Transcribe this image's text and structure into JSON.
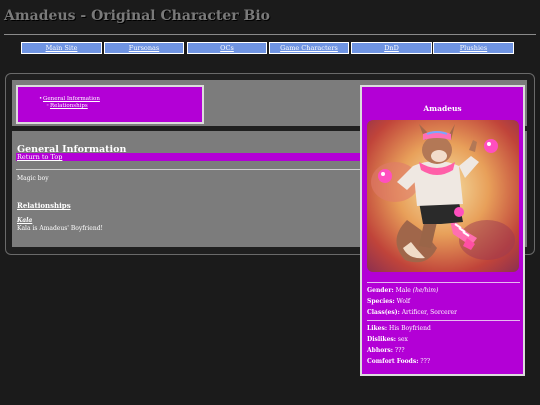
{
  "page": {
    "title": "Amadeus - Original Character Bio"
  },
  "nav": [
    {
      "label": "Main Site"
    },
    {
      "label": "Fursonas"
    },
    {
      "label": "OCs"
    },
    {
      "label": "Game Characters"
    },
    {
      "label": "DnD"
    },
    {
      "label": "Plushies"
    }
  ],
  "toc": {
    "items": [
      "General Information",
      "Relationships"
    ]
  },
  "general": {
    "heading": "General Information",
    "return_link": "Return to Top",
    "text": "Magic boy"
  },
  "relationships": {
    "heading": "Relationships",
    "name": "Kala",
    "description": "Kala is Amadeus' Boyfriend!"
  },
  "profile": {
    "name": "Amadeus",
    "gender_label": "Gender:",
    "gender_value": "Male",
    "pronouns": "(he/him)",
    "species_label": "Species:",
    "species_value": "Wolf",
    "class_label": "Class(es):",
    "class_value": "Artificer, Sorcerer",
    "likes_label": "Likes:",
    "likes_value": "His Boyfriend",
    "dislikes_label": "Dislikes:",
    "dislikes_value": "sex",
    "abhors_label": "Abhors:",
    "abhors_value": "???",
    "comfort_label": "Comfort Foods:",
    "comfort_value": "???"
  },
  "colors": {
    "accent": "#b300d6",
    "nav": "#6f94e2",
    "panel": "#7c7c7c",
    "background": "#1b1b1b"
  }
}
